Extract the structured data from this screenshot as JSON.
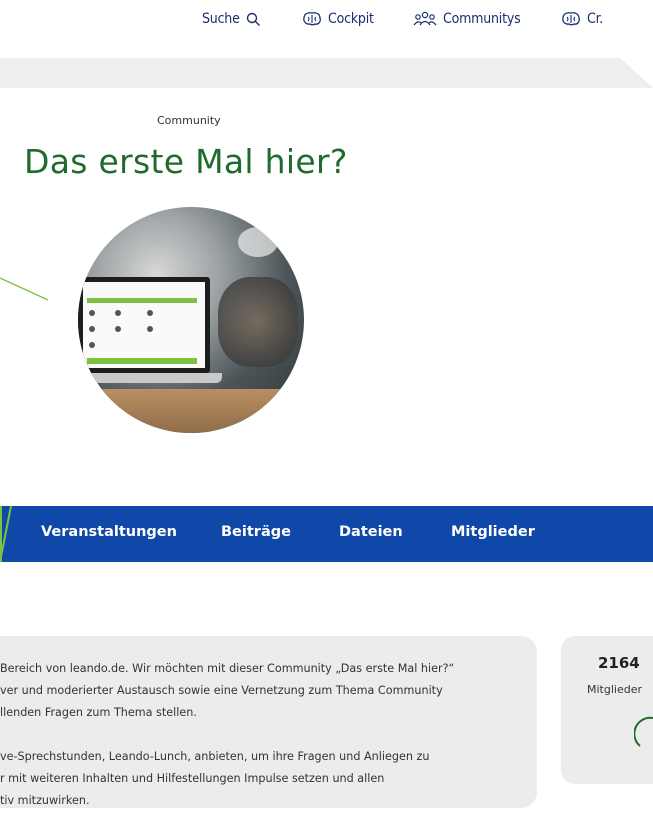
{
  "nav": {
    "search_label": "Suche",
    "cockpit_label": "Cockpit",
    "communitys_label": "Communitys",
    "cut_label": "Cr."
  },
  "hero": {
    "kicker": "Community",
    "title": "Das erste Mal hier?"
  },
  "tabs": [
    {
      "label": "Veranstaltungen"
    },
    {
      "label": "Beiträge"
    },
    {
      "label": "Dateien"
    },
    {
      "label": "Mitglieder"
    }
  ],
  "description": {
    "paragraph1": [
      "Bereich von leando.de. Wir möchten mit dieser Community „Das erste Mal hier?“",
      "ver und moderierter Austausch sowie eine Vernetzung zum Thema Community",
      "llenden Fragen zum Thema stellen."
    ],
    "paragraph2": [
      "ve-Sprechstunden, Leando-Lunch, anbieten, um ihre Fragen und Anliegen zu",
      "r mit weiteren Inhalten und Hilfestellungen Impulse setzen und allen",
      "tiv mitzuwirken."
    ]
  },
  "stats": {
    "members_count": "2164",
    "members_label": "Mitglieder"
  },
  "colors": {
    "nav_text": "#1a2f6e",
    "title_green": "#1f6b2b",
    "tabbar_blue": "#0f48a8",
    "accent_green": "#7cc142"
  },
  "icons": {
    "search": "search-icon",
    "cockpit": "brain-icon",
    "communitys": "people-icon",
    "cut": "brain-icon"
  }
}
